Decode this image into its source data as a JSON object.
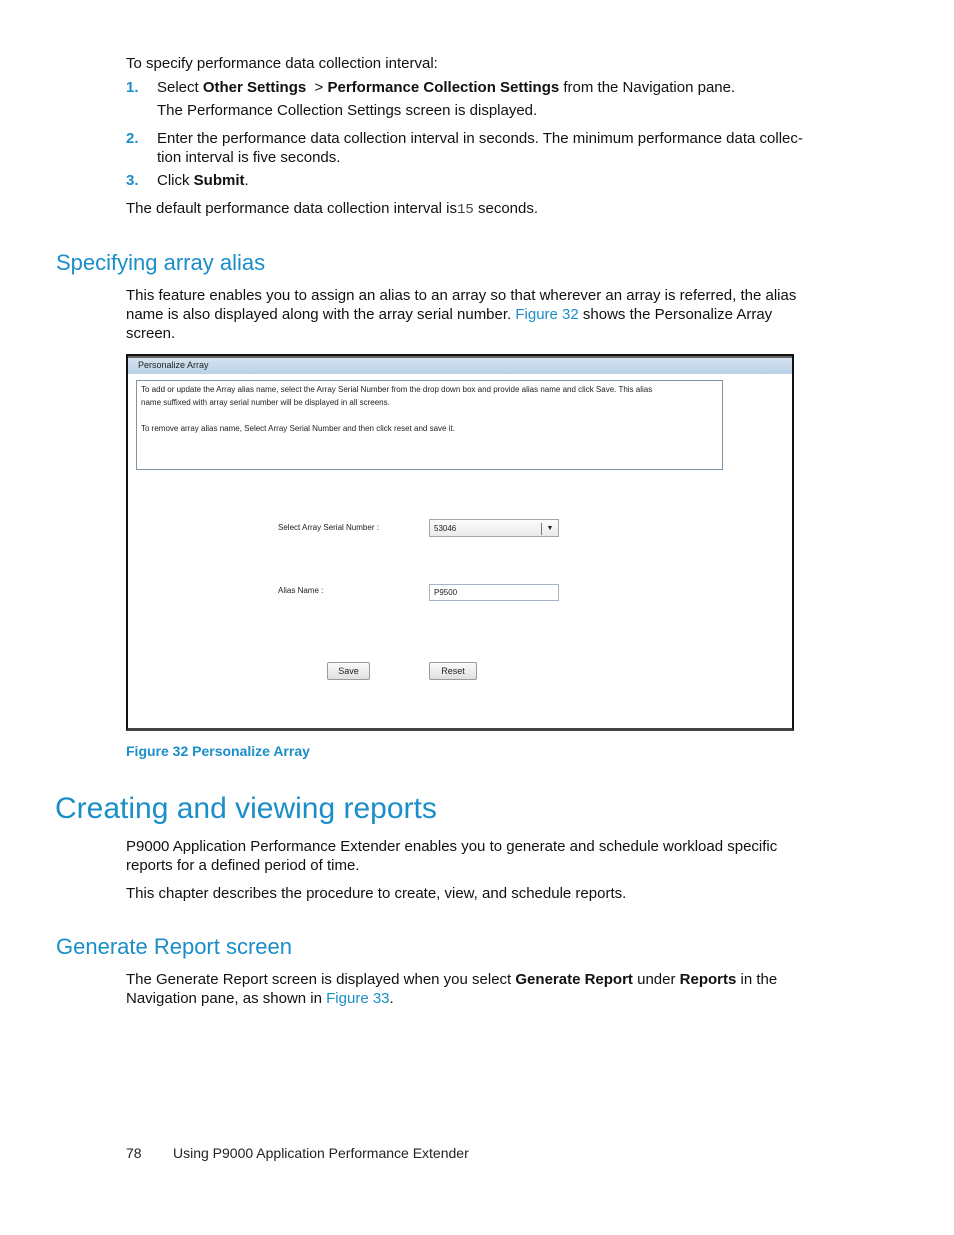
{
  "intro": "To specify performance data collection interval:",
  "steps": [
    {
      "num": "1.",
      "pre": "Select ",
      "b1": "Other Settings",
      "mid": "  > ",
      "b2": "Performance Collection Settings",
      "post": " from the Navigation pane.",
      "sub": "The Performance Collection Settings screen is displayed."
    },
    {
      "num": "2.",
      "line1": "Enter the performance data collection interval in seconds. The minimum performance data collec-",
      "line2": "tion interval is five seconds."
    },
    {
      "num": "3.",
      "pre": "Click ",
      "b1": "Submit",
      "post": "."
    }
  ],
  "default_pre": "The default performance data collection interval is",
  "default_value": "15",
  "default_post": " seconds.",
  "section1": {
    "title": "Specifying array alias",
    "para_l1": "This feature enables you to assign an alias to an array so that wherever an array is referred, the alias",
    "para_l2_pre": "name is also displayed along with the array serial number. ",
    "para_l2_link": "Figure 32",
    "para_l2_post": " shows the Personalize Array",
    "para_l3": "screen."
  },
  "figure": {
    "panel_title": "Personalize Array",
    "info_line1": "To add or update the Array alias name, select the Array Serial Number from the drop down box and provide alias name and click Save. This alias",
    "info_line2": "name suffixed with array serial number will be displayed in all screens.",
    "info_line3": "To remove array alias name, Select Array Serial Number and then click  reset and save it.",
    "serial_label": "Select Array Serial Number :",
    "serial_value": "53046",
    "alias_label": "Alias Name :",
    "alias_value": "P9500",
    "save_label": "Save",
    "reset_label": "Reset",
    "caption": "Figure 32 Personalize Array"
  },
  "chapter": {
    "title": "Creating and viewing reports",
    "para1_l1": "P9000 Application Performance Extender enables you to generate and schedule workload specific",
    "para1_l2": "reports for a defined period of time.",
    "para2": "This chapter describes the procedure to create, view, and schedule reports."
  },
  "section2": {
    "title": "Generate Report screen",
    "l1_pre": "The Generate Report screen is displayed when you select ",
    "l1_b1": "Generate Report",
    "l1_mid": " under ",
    "l1_b2": "Reports",
    "l1_post": " in the",
    "l2_pre": "Navigation pane, as shown in ",
    "l2_link": "Figure 33",
    "l2_post": "."
  },
  "footer": {
    "page_number": "78",
    "title": "Using P9000 Application Performance Extender"
  }
}
